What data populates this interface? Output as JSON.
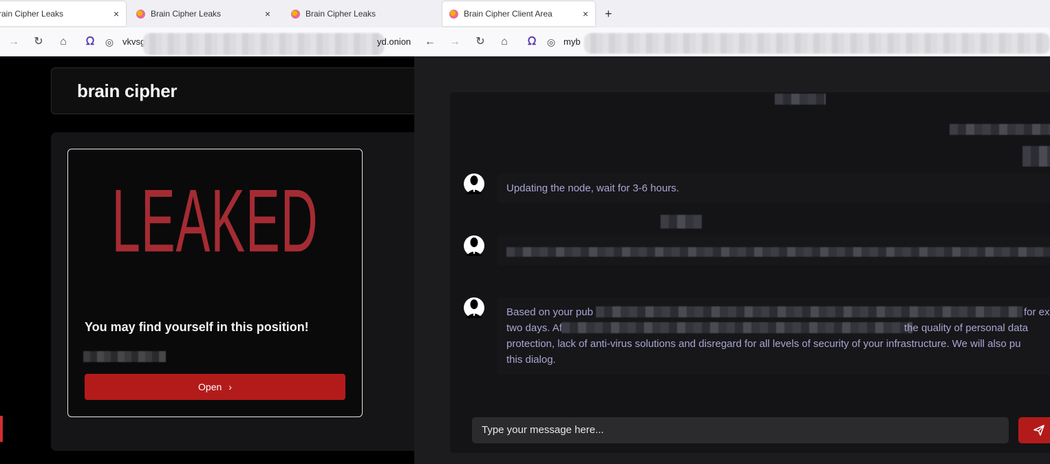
{
  "left_window": {
    "tabs": [
      {
        "label": "rain Cipher Leaks",
        "close": "×"
      },
      {
        "label": "Brain Cipher Leaks",
        "close": "×"
      },
      {
        "label": "Brain Cipher Leaks"
      }
    ],
    "url_prefix": "vkvsg",
    "url_suffix": "yd.onion",
    "brand": "brain cipher",
    "card": {
      "image_text": "LEAKED",
      "title": "You may find yourself in this position!",
      "button_label": "Open",
      "button_icon": "chevron-right-icon"
    }
  },
  "right_window": {
    "tab": {
      "label": "Brain Cipher Client Area",
      "close": "×"
    },
    "new_tab": "+",
    "url_prefix": "myb",
    "messages": [
      {
        "text": "Updating the node, wait for 3-6 hours."
      },
      {
        "text": ""
      },
      {
        "line1_start": "Based on your pub",
        "line1_end": "for ex",
        "line2_start": "two days. Af",
        "line2_end": "the quality of personal data",
        "line3": "protection, lack of anti-virus solutions and disregard for all levels of security of your infrastructure. We will also pu",
        "line4": "this dialog."
      }
    ],
    "composer_placeholder": "Type your message here...",
    "send_icon": "send-icon"
  },
  "colors": {
    "accent_red": "#b31b1b",
    "leak_red": "#a52b33",
    "message_text": "#a8a6d2"
  }
}
